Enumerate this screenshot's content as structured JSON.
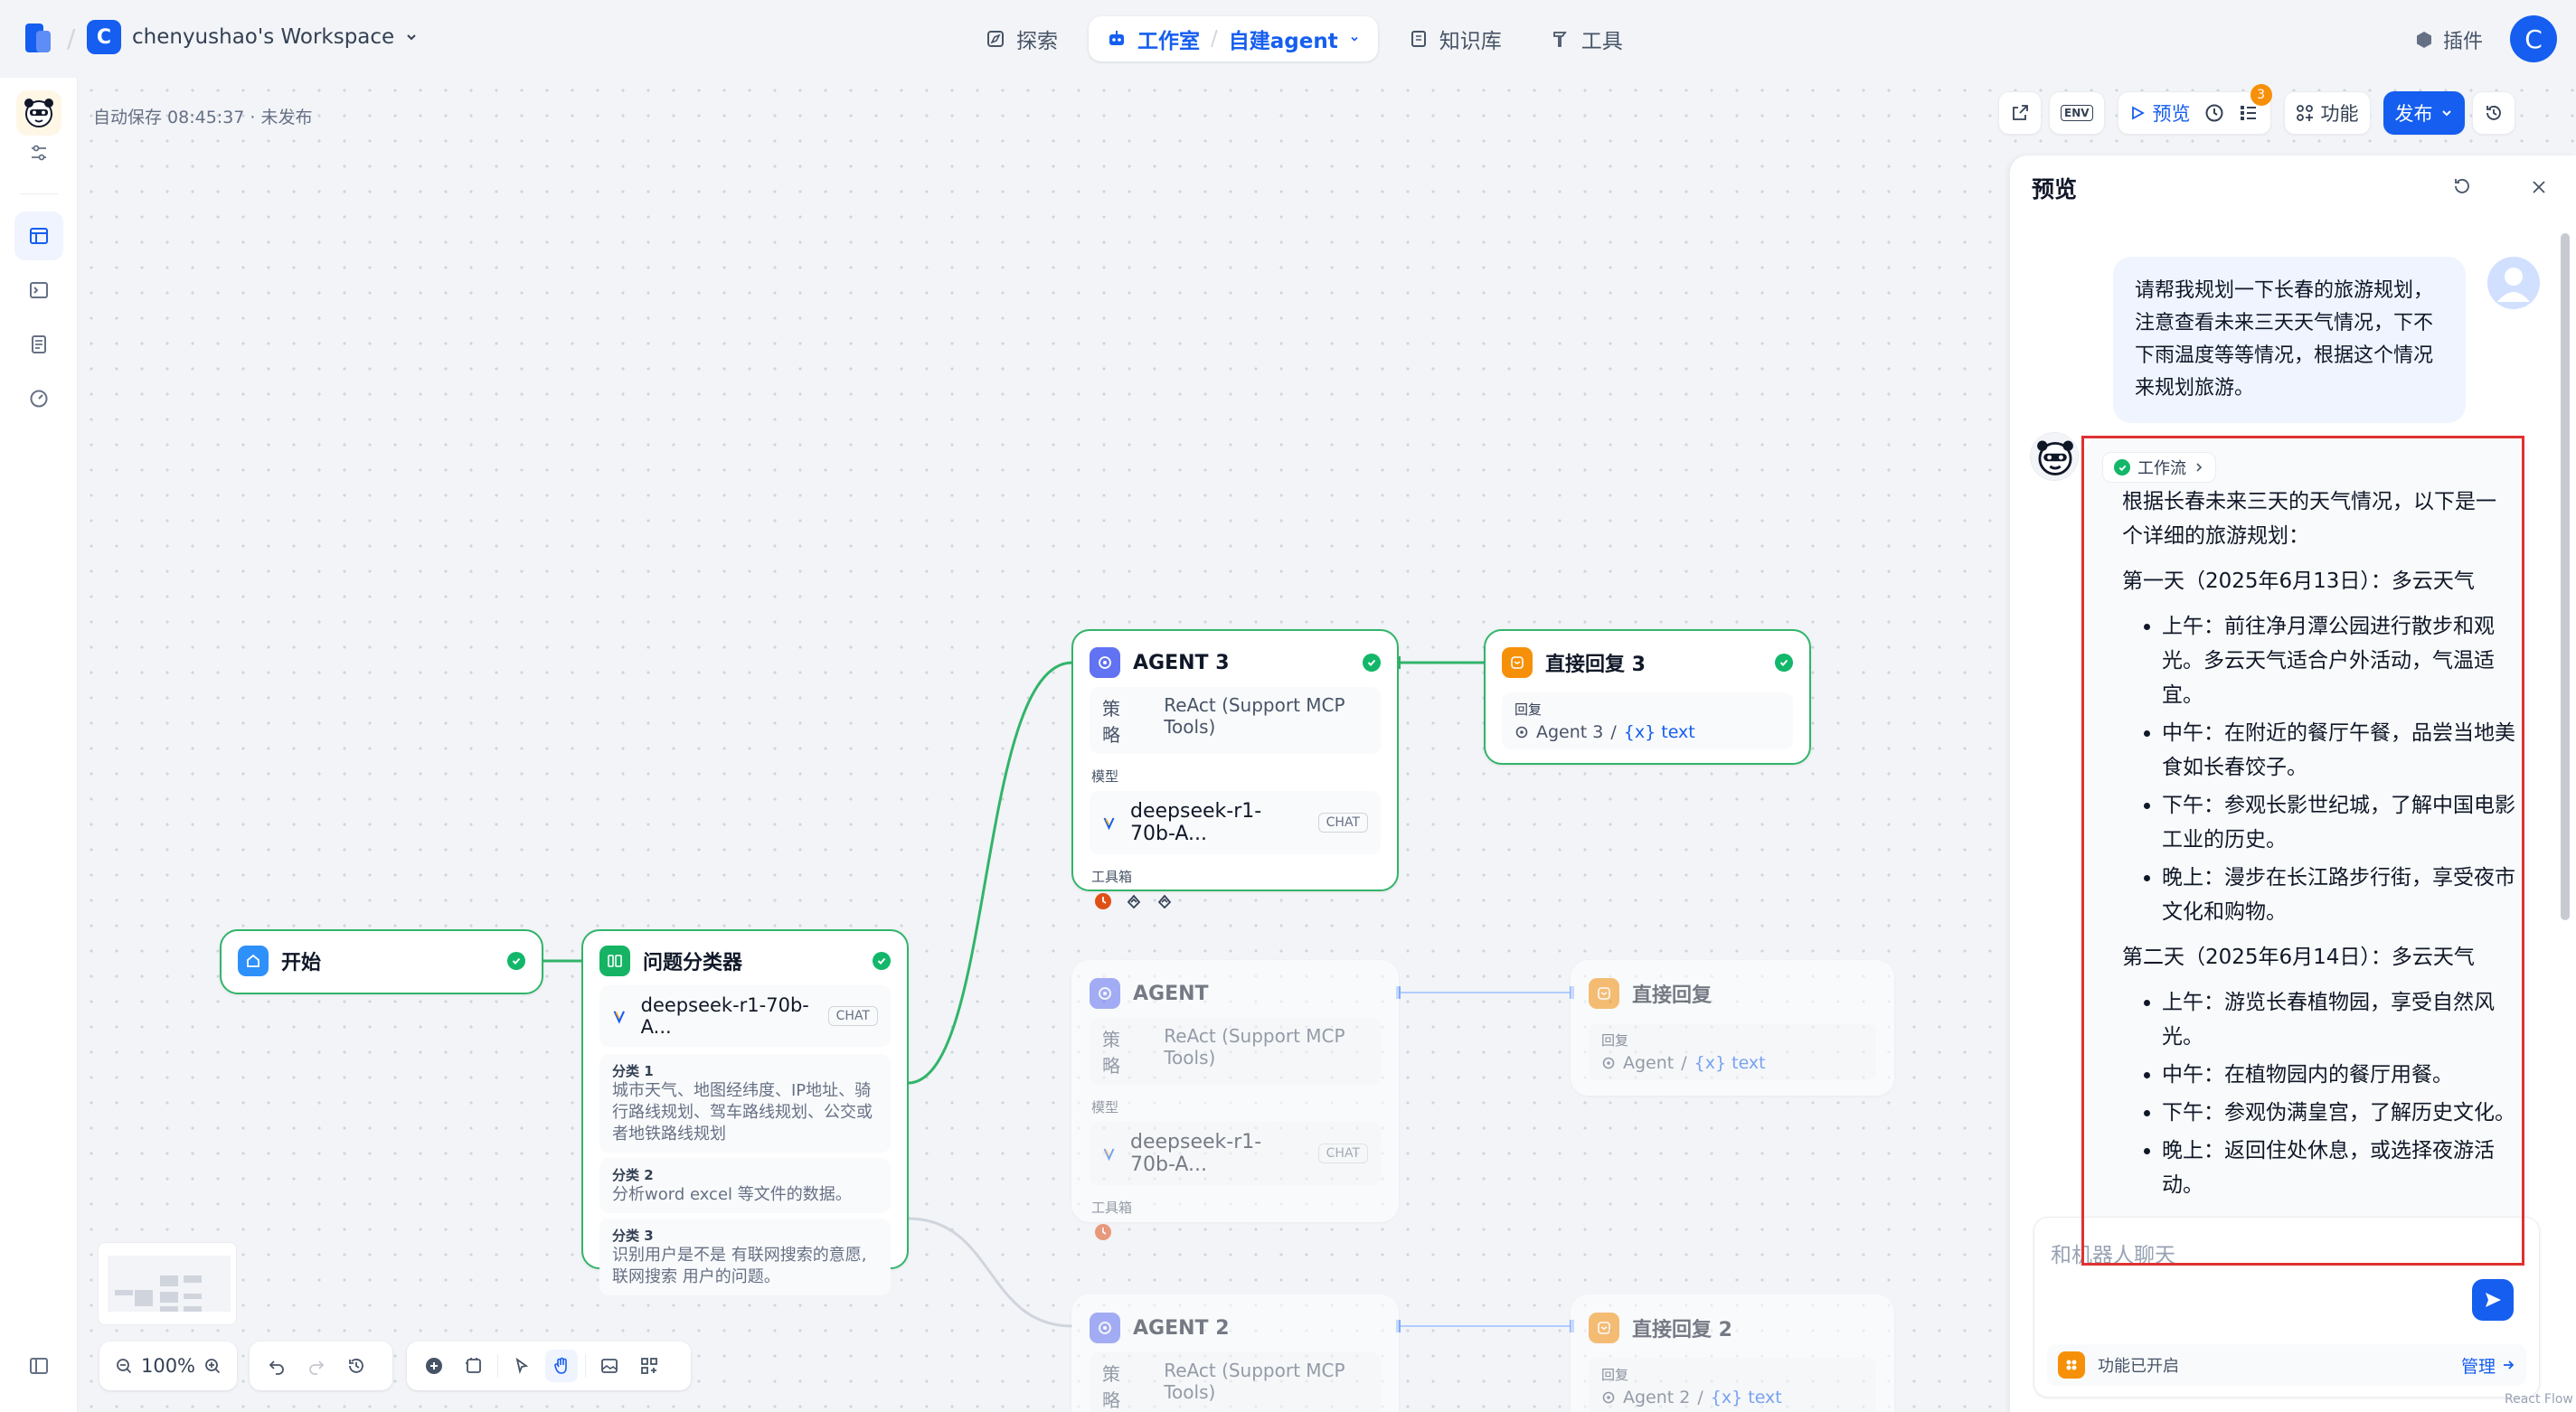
{
  "topbar": {
    "workspace_initial": "C",
    "workspace_name": "chenyushao's Workspace",
    "nav": {
      "explore": "探索",
      "studio": "工作室",
      "app_name": "自建agent",
      "knowledge": "知识库",
      "tools": "工具"
    },
    "plugins": "插件",
    "user_initial": "C"
  },
  "canvas": {
    "autosave": "自动保存 08:45:37 · 未发布",
    "toolbar": {
      "env": "ENV",
      "preview": "预览",
      "checklist_count": "3",
      "features": "功能",
      "publish": "发布"
    },
    "zoom": "100%"
  },
  "nodes": {
    "start": {
      "title": "开始"
    },
    "classifier": {
      "title": "问题分类器",
      "model": "deepseek-r1-70b-A...",
      "model_tag": "CHAT",
      "classes": [
        {
          "label": "分类 1",
          "desc": "城市天气、地图经纬度、IP地址、骑行路线规划、驾车路线规划、公交或者地铁路线规划"
        },
        {
          "label": "分类 2",
          "desc": "分析word excel 等文件的数据。"
        },
        {
          "label": "分类 3",
          "desc": "识别用户是不是 有联网搜索的意愿, 联网搜索 用户的问题。"
        }
      ]
    },
    "agent3": {
      "title": "AGENT 3",
      "strategy_label": "策略",
      "strategy": "ReAct (Support MCP Tools)",
      "model_label": "模型",
      "model": "deepseek-r1-70b-A...",
      "model_tag": "CHAT",
      "tools_label": "工具箱"
    },
    "agent": {
      "title": "AGENT",
      "strategy_label": "策略",
      "strategy": "ReAct (Support MCP Tools)",
      "model_label": "模型",
      "model": "deepseek-r1-70b-A...",
      "model_tag": "CHAT",
      "tools_label": "工具箱"
    },
    "agent2": {
      "title": "AGENT 2",
      "strategy_label": "策略",
      "strategy": "ReAct (Support MCP Tools)"
    },
    "reply3": {
      "title": "直接回复 3",
      "label": "回复",
      "source": "Agent 3",
      "sep": "/",
      "var": "{x} text"
    },
    "reply": {
      "title": "直接回复",
      "label": "回复",
      "source": "Agent",
      "sep": "/",
      "var": "{x} text"
    },
    "reply2": {
      "title": "直接回复 2",
      "label": "回复",
      "source": "Agent 2",
      "sep": "/",
      "var": "{x} text"
    }
  },
  "preview": {
    "title": "预览",
    "user_message": "请帮我规划一下长春的旅游规划，注意查看未来三天天气情况，下不下雨温度等等情况，根据这个情况来规划旅游。",
    "workflow_label": "工作流",
    "answer_intro": "根据长春未来三天的天气情况，以下是一个详细的旅游规划：",
    "day1_title": "第一天（2025年6月13日）：多云天气",
    "day1": [
      "上午：前往净月潭公园进行散步和观光。多云天气适合户外活动，气温适宜。",
      "中午：在附近的餐厅午餐，品尝当地美食如长春饺子。",
      "下午：参观长影世纪城，了解中国电影工业的历史。",
      "晚上：漫步在长江路步行街，享受夜市文化和购物。"
    ],
    "day2_title": "第二天（2025年6月14日）：多云天气",
    "day2": [
      "上午：游览长春植物园，享受自然风光。",
      "中午：在植物园内的餐厅用餐。",
      "下午：参观伪满皇宫，了解历史文化。",
      "晚上：返回住处休息，或选择夜游活动。"
    ],
    "chat_placeholder": "和机器人聊天",
    "features_enabled": "功能已开启",
    "manage": "管理"
  },
  "footer": "React Flow"
}
